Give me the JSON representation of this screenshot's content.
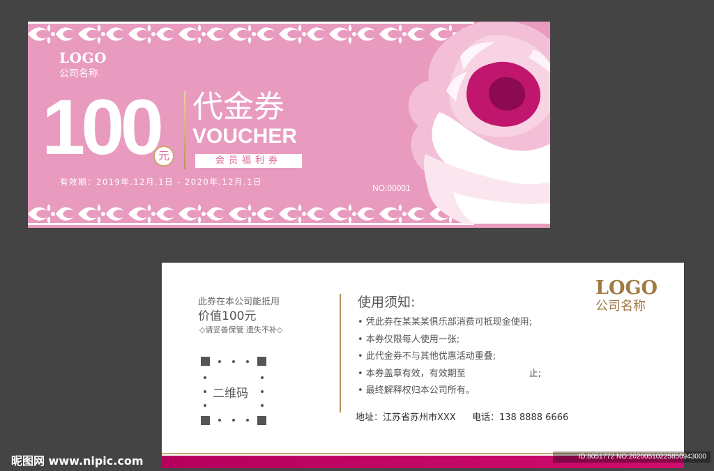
{
  "front": {
    "logo": "LOGO",
    "company": "公司名称",
    "amount": "100",
    "yuan": "元",
    "title_cn": "代金券",
    "title_en": "VOUCHER",
    "member": "会员福利券",
    "validity": "有效期：2019年.12月.1日 - 2020年.12月.1日",
    "serial": "NO:00001",
    "colors": {
      "background": "#e89bbf",
      "accent": "#c9a66b",
      "peony_deep": "#c0166e"
    }
  },
  "back": {
    "worth_line1": "此券在本公司能抵用",
    "worth_line2": "价值100元",
    "keep_line": "◇请妥善保管 遗失不补◇",
    "qr_label": "二维码",
    "notice_title": "使用须知:",
    "notices": [
      "• 凭此券在某某某俱乐部消费可抵现金使用;",
      "• 本券仅限每人使用一张;",
      "• 此代金券不与其他优惠活动重叠;",
      "• 本券盖章有效，有效期至                      止;",
      "• 最终解释权归本公司所有。"
    ],
    "address": "地址：江苏省苏州市XXX",
    "phone": "电话：138 8888 6666",
    "logo": "LOGO",
    "company": "公司名称",
    "colors": {
      "bar": "#c0126a",
      "gold": "#a17a43"
    }
  },
  "watermark": {
    "site": "昵图网 www.nipic.com",
    "id": "ID:8051772 NO:20200510225850943000"
  }
}
